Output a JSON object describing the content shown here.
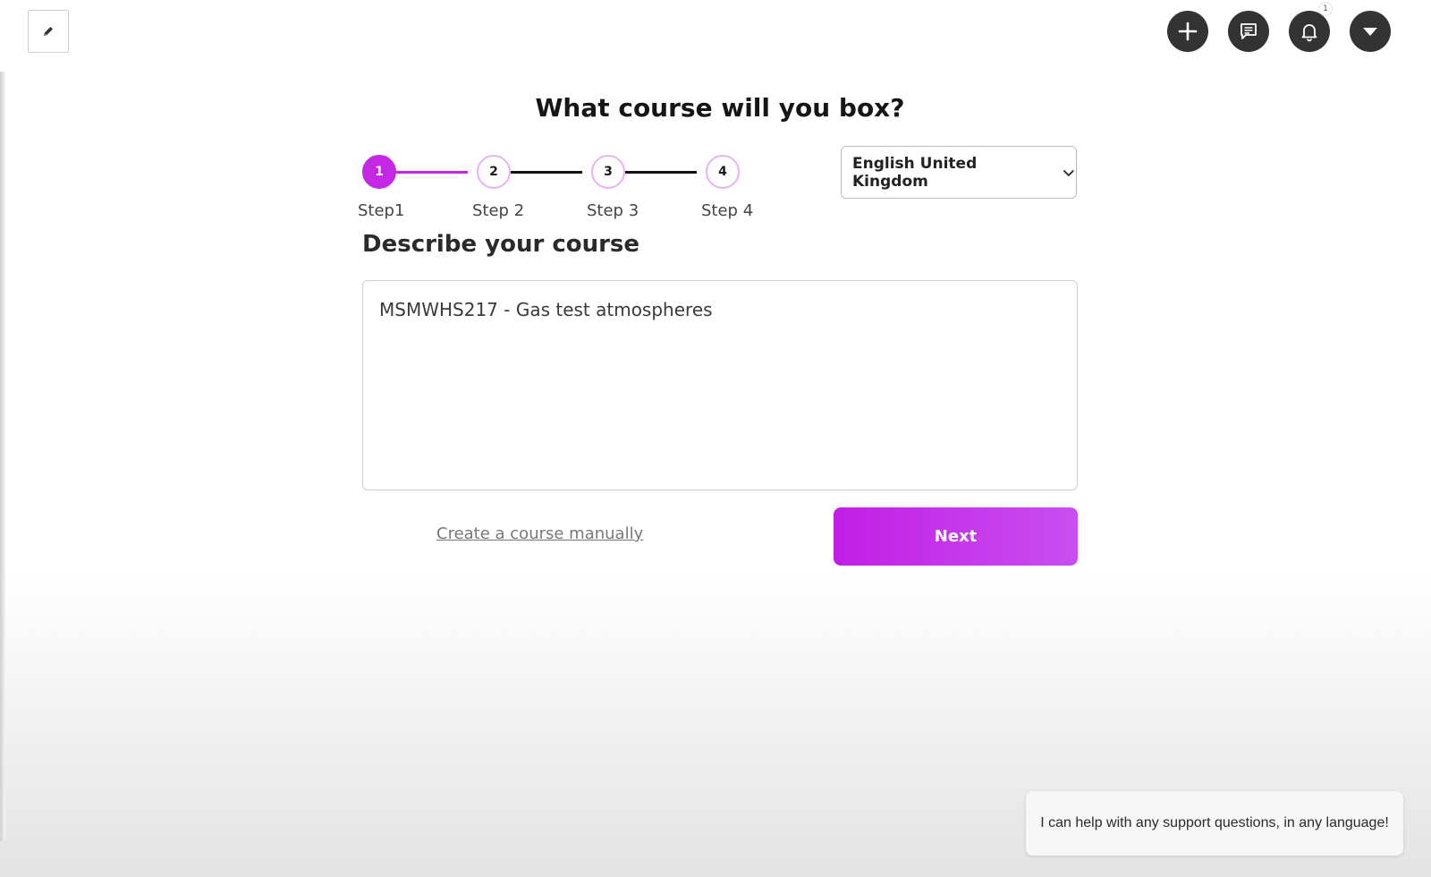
{
  "header": {
    "edit_icon": "pencil-icon",
    "actions": [
      {
        "icon": "plus-icon",
        "name": "create-button"
      },
      {
        "icon": "chat-icon",
        "name": "messages-button"
      },
      {
        "icon": "bell-icon",
        "name": "notifications-button",
        "badge": "1"
      },
      {
        "icon": "caret-down-icon",
        "name": "account-menu-button"
      }
    ]
  },
  "page": {
    "title": "What course will you box?",
    "section_title": "Describe your course"
  },
  "stepper": {
    "steps": [
      {
        "number": "1",
        "label": "Step1",
        "active": true
      },
      {
        "number": "2",
        "label": "Step 2",
        "active": false
      },
      {
        "number": "3",
        "label": "Step 3",
        "active": false
      },
      {
        "number": "4",
        "label": "Step 4",
        "active": false
      }
    ]
  },
  "language": {
    "selected": "English United Kingdom"
  },
  "form": {
    "course_description": "MSMWHS217 - Gas test atmospheres",
    "manual_link": "Create a course manually",
    "next_label": "Next"
  },
  "support": {
    "message": "I can help with any support questions, in any language!"
  },
  "colors": {
    "accent": "#c528e5",
    "accent_light": "#e9b2f5",
    "dark_button": "#333333"
  }
}
